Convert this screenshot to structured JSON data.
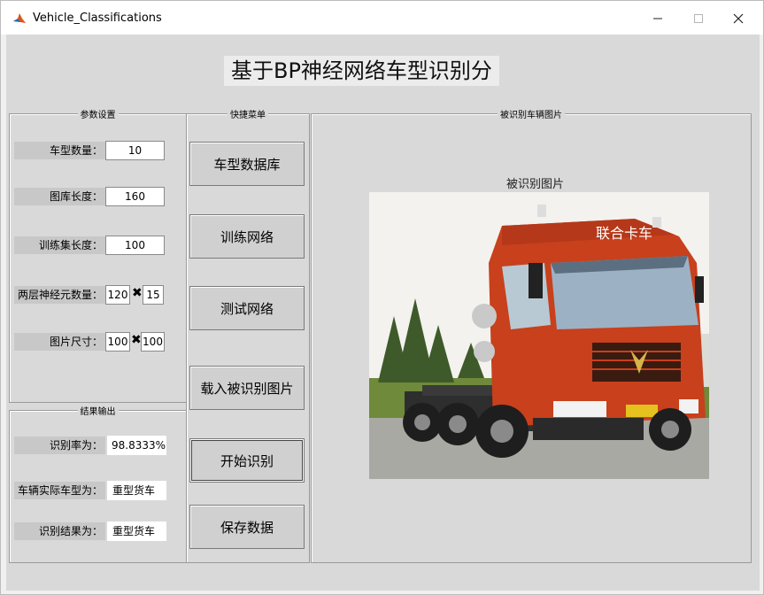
{
  "window": {
    "title": "Vehicle_Classifications"
  },
  "header": {
    "title": "基于BP神经网络车型识别分"
  },
  "params_panel": {
    "title": "参数设置",
    "vehicle_count_label": "车型数量：",
    "vehicle_count_value": "10",
    "library_length_label": "图库长度：",
    "library_length_value": "160",
    "train_length_label": "训练集长度：",
    "train_length_value": "100",
    "neurons_label": "两层神经元数量：",
    "neurons_value_1": "120",
    "neurons_value_2": "15",
    "image_size_label": "图片尺寸：",
    "image_size_w": "100",
    "image_size_h": "100",
    "times_symbol": "✖"
  },
  "results_panel": {
    "title": "结果输出",
    "rate_label": "识别率为：",
    "rate_value": "98.8333%",
    "actual_label": "车辆实际车型为：",
    "actual_value": "重型货车",
    "result_label": "识别结果为：",
    "result_value": "重型货车"
  },
  "menu_panel": {
    "title": "快捷菜单",
    "buttons": [
      "车型数据库",
      "训练网络",
      "测试网络",
      "载入被识别图片",
      "开始识别",
      "保存数据"
    ]
  },
  "image_panel": {
    "title": "被识别车辆图片",
    "caption": "被识别图片",
    "truck_brand_text": "联合卡车"
  },
  "colors": {
    "truck_red": "#c8401c",
    "sky": "#f3f2ee",
    "grass": "#6e8a3a"
  }
}
